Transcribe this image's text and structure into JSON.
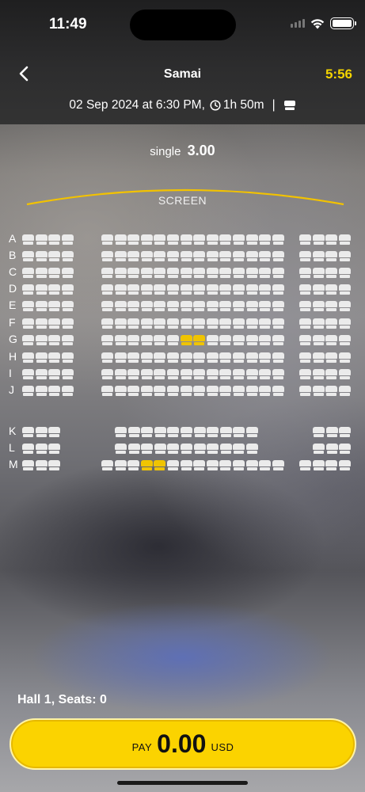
{
  "status_bar": {
    "time": "11:49",
    "icons": [
      "signal-icon",
      "wifi-icon",
      "battery-icon"
    ]
  },
  "header": {
    "back_icon": "chevron-left-icon",
    "title": "Samai",
    "timer": "5:56",
    "date_time": "02 Sep 2024 at 6:30 PM,",
    "duration": "1h 50m",
    "separator": "|",
    "seat_icon": "seat-icon"
  },
  "pricing": {
    "label": "single",
    "value": "3.00"
  },
  "screen": {
    "label": "SCREEN"
  },
  "seat_map": {
    "rows": [
      {
        "label": "A",
        "groups": [
          4,
          14,
          4
        ],
        "selected": []
      },
      {
        "label": "B",
        "groups": [
          4,
          14,
          4
        ],
        "selected": []
      },
      {
        "label": "C",
        "groups": [
          4,
          14,
          4
        ],
        "selected": []
      },
      {
        "label": "D",
        "groups": [
          4,
          14,
          4
        ],
        "selected": []
      },
      {
        "label": "E",
        "groups": [
          4,
          14,
          4
        ],
        "selected": []
      },
      {
        "label": "F",
        "groups": [
          4,
          14,
          4
        ],
        "selected": []
      },
      {
        "label": "G",
        "groups": [
          4,
          14,
          4
        ],
        "selected": [
          [
            1,
            6
          ],
          [
            1,
            7
          ]
        ]
      },
      {
        "label": "H",
        "groups": [
          4,
          14,
          4
        ],
        "selected": []
      },
      {
        "label": "I",
        "groups": [
          4,
          14,
          4
        ],
        "selected": []
      },
      {
        "label": "J",
        "groups": [
          4,
          14,
          4
        ],
        "selected": []
      },
      {
        "label": "K",
        "groups": [
          3,
          11,
          3
        ],
        "selected": []
      },
      {
        "label": "L",
        "groups": [
          3,
          11,
          3
        ],
        "selected": []
      },
      {
        "label": "M",
        "groups": [
          3,
          14,
          4
        ],
        "selected": [
          [
            1,
            3
          ],
          [
            1,
            4
          ]
        ]
      }
    ],
    "colors": {
      "available": "#ebebeb",
      "selected": "#f0c400"
    }
  },
  "summary": {
    "hall_info": "Hall 1, Seats: 0"
  },
  "pay_button": {
    "label": "PAY",
    "amount": "0.00",
    "currency": "USD"
  },
  "colors": {
    "accent": "#fbd300",
    "timer": "#f4d400",
    "header_bg": "#2a2a2b"
  }
}
